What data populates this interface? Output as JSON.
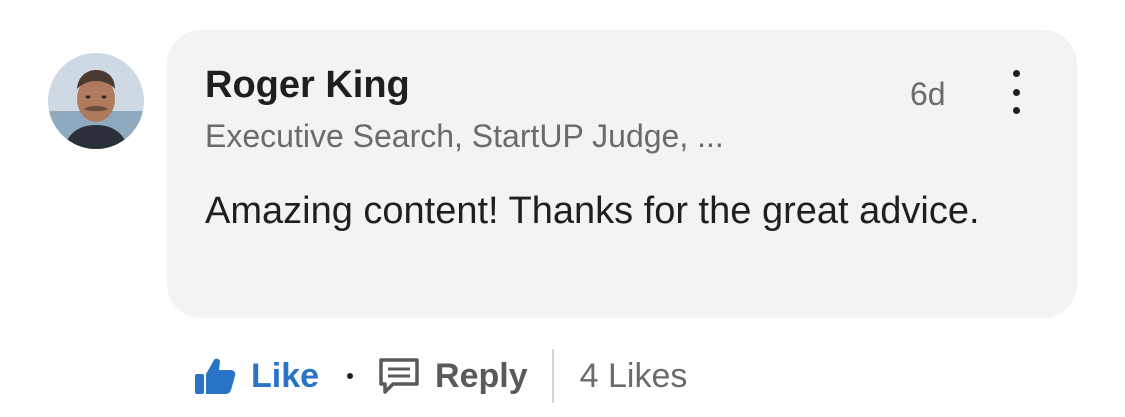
{
  "comment": {
    "author": {
      "name": "Roger King",
      "headline": "Executive Search, StartUP Judge, ..."
    },
    "timestamp": "6d",
    "text": "Amazing content!  Thanks for the great advice."
  },
  "actions": {
    "like_label": "Like",
    "reply_label": "Reply",
    "likes_count": "4 Likes"
  },
  "icons": {
    "like": "thumbs-up-icon",
    "reply": "reply-icon",
    "more": "more-vertical-icon"
  },
  "colors": {
    "like_accent": "#2a74c7",
    "bubble_background": "#f3f3f5"
  }
}
